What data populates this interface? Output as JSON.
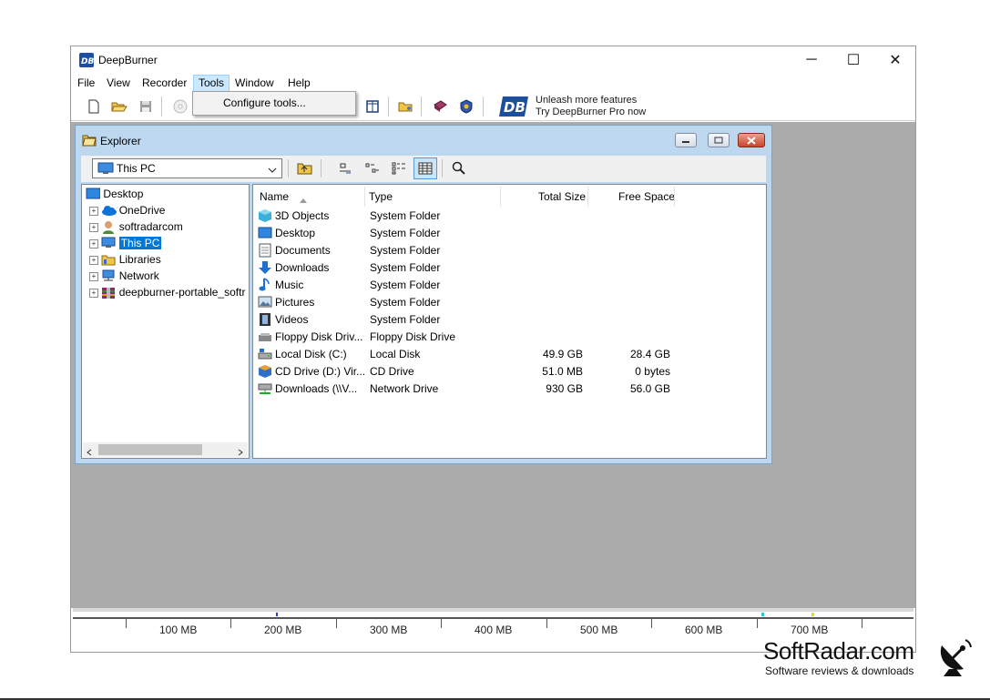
{
  "app": {
    "title": "DeepBurner",
    "icon": "db-logo-icon"
  },
  "window_controls": {
    "minimize": "─",
    "maximize": "☐",
    "close": "✕"
  },
  "menu": {
    "file": "File",
    "view": "View",
    "recorder": "Recorder",
    "tools": "Tools",
    "window": "Window",
    "help": "Help"
  },
  "tools_menu": {
    "item": "Configure tools..."
  },
  "promo": {
    "line1": "Unleash more features",
    "line2": "Try DeepBurner Pro now"
  },
  "explorer": {
    "title": "Explorer",
    "location": "This PC",
    "tree": [
      {
        "label": "Desktop",
        "icon": "desktop-icon"
      },
      {
        "label": "OneDrive",
        "icon": "cloud-icon"
      },
      {
        "label": "softradarcom",
        "icon": "user-icon"
      },
      {
        "label": "This PC",
        "icon": "computer-icon"
      },
      {
        "label": "Libraries",
        "icon": "libraries-icon"
      },
      {
        "label": "Network",
        "icon": "network-icon"
      },
      {
        "label": "deepburner-portable_softr",
        "icon": "archive-icon"
      }
    ],
    "columns": {
      "name": "Name",
      "type": "Type",
      "total": "Total Size",
      "free": "Free Space"
    },
    "rows": [
      {
        "name": "3D Objects",
        "type": "System Folder",
        "total": "",
        "free": ""
      },
      {
        "name": "Desktop",
        "type": "System Folder",
        "total": "",
        "free": ""
      },
      {
        "name": "Documents",
        "type": "System Folder",
        "total": "",
        "free": ""
      },
      {
        "name": "Downloads",
        "type": "System Folder",
        "total": "",
        "free": ""
      },
      {
        "name": "Music",
        "type": "System Folder",
        "total": "",
        "free": ""
      },
      {
        "name": "Pictures",
        "type": "System Folder",
        "total": "",
        "free": ""
      },
      {
        "name": "Videos",
        "type": "System Folder",
        "total": "",
        "free": ""
      },
      {
        "name": "Floppy Disk Driv...",
        "type": "Floppy Disk Drive",
        "total": "",
        "free": ""
      },
      {
        "name": "Local Disk (C:)",
        "type": "Local Disk",
        "total": "49.9 GB",
        "free": "28.4 GB"
      },
      {
        "name": "CD Drive (D:) Vir...",
        "type": "CD Drive",
        "total": "51.0 MB",
        "free": "0 bytes"
      },
      {
        "name": "Downloads (\\\\V...",
        "type": "Network Drive",
        "total": "930 GB",
        "free": "56.0 GB"
      }
    ]
  },
  "scale": {
    "labels": [
      "100 MB",
      "200 MB",
      "300 MB",
      "400 MB",
      "500 MB",
      "600 MB",
      "700 MB"
    ]
  },
  "watermark": {
    "brand": "SoftRadar.com",
    "tagline": "Software reviews & downloads"
  },
  "colors": {
    "selection": "#0078d7",
    "workspace": "#ababab",
    "explorer_frame": "#bcd7ee"
  }
}
